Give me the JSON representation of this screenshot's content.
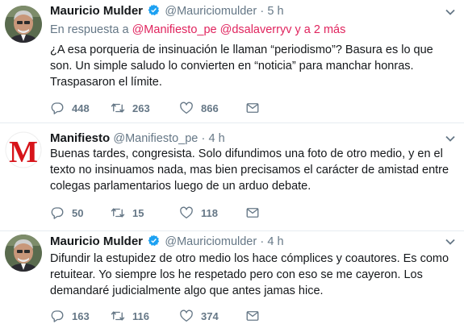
{
  "tweets": [
    {
      "name": "Mauricio Mulder",
      "verified": true,
      "handle": "@Mauriciomulder",
      "separator": "·",
      "time": "5 h",
      "reply_prefix": "En respuesta a",
      "reply_mentions": "@Manifiesto_pe @dsalaverryv",
      "reply_suffix": "y a 2 más",
      "text": "¿A esa porqueria de insinuación le llaman “periodismo”? Basura es lo que son. Un simple saludo lo convierten en “noticia” para manchar honras.  Traspasaron el límite.",
      "replies": "448",
      "retweets": "263",
      "likes": "866"
    },
    {
      "name": "Manifiesto",
      "verified": false,
      "handle": "@Manifiesto_pe",
      "separator": "·",
      "time": "4 h",
      "text": "Buenas tardes, congresista. Solo difundimos una foto de otro medio, y en el texto no insinuamos nada, mas bien precisamos el carácter de amistad entre colegas parlamentarios luego de un arduo debate.",
      "replies": "50",
      "retweets": "15",
      "likes": "118",
      "avatar_logo": "M"
    },
    {
      "name": "Mauricio Mulder",
      "verified": true,
      "handle": "@Mauriciomulder",
      "separator": "·",
      "time": "4 h",
      "text": "Difundir la estupidez de otro medio los hace cómplices  y coautores. Es como retuitear. Yo siempre los he respetado pero con eso se me cayeron. Los demandaré judicialmente algo que antes jamas hice.",
      "replies": "163",
      "retweets": "116",
      "likes": "374"
    }
  ],
  "colors": {
    "text": "#14171a",
    "secondary": "#657786",
    "link": "#e0245e",
    "verified": "#1da1f2",
    "divider": "#e6ecf0",
    "manifiesto_red": "#d7141a"
  },
  "icons": {
    "reply": "reply-icon",
    "retweet": "retweet-icon",
    "like": "heart-icon",
    "dm": "envelope-icon",
    "caret": "chevron-down-icon",
    "verified": "verified-badge-icon"
  }
}
